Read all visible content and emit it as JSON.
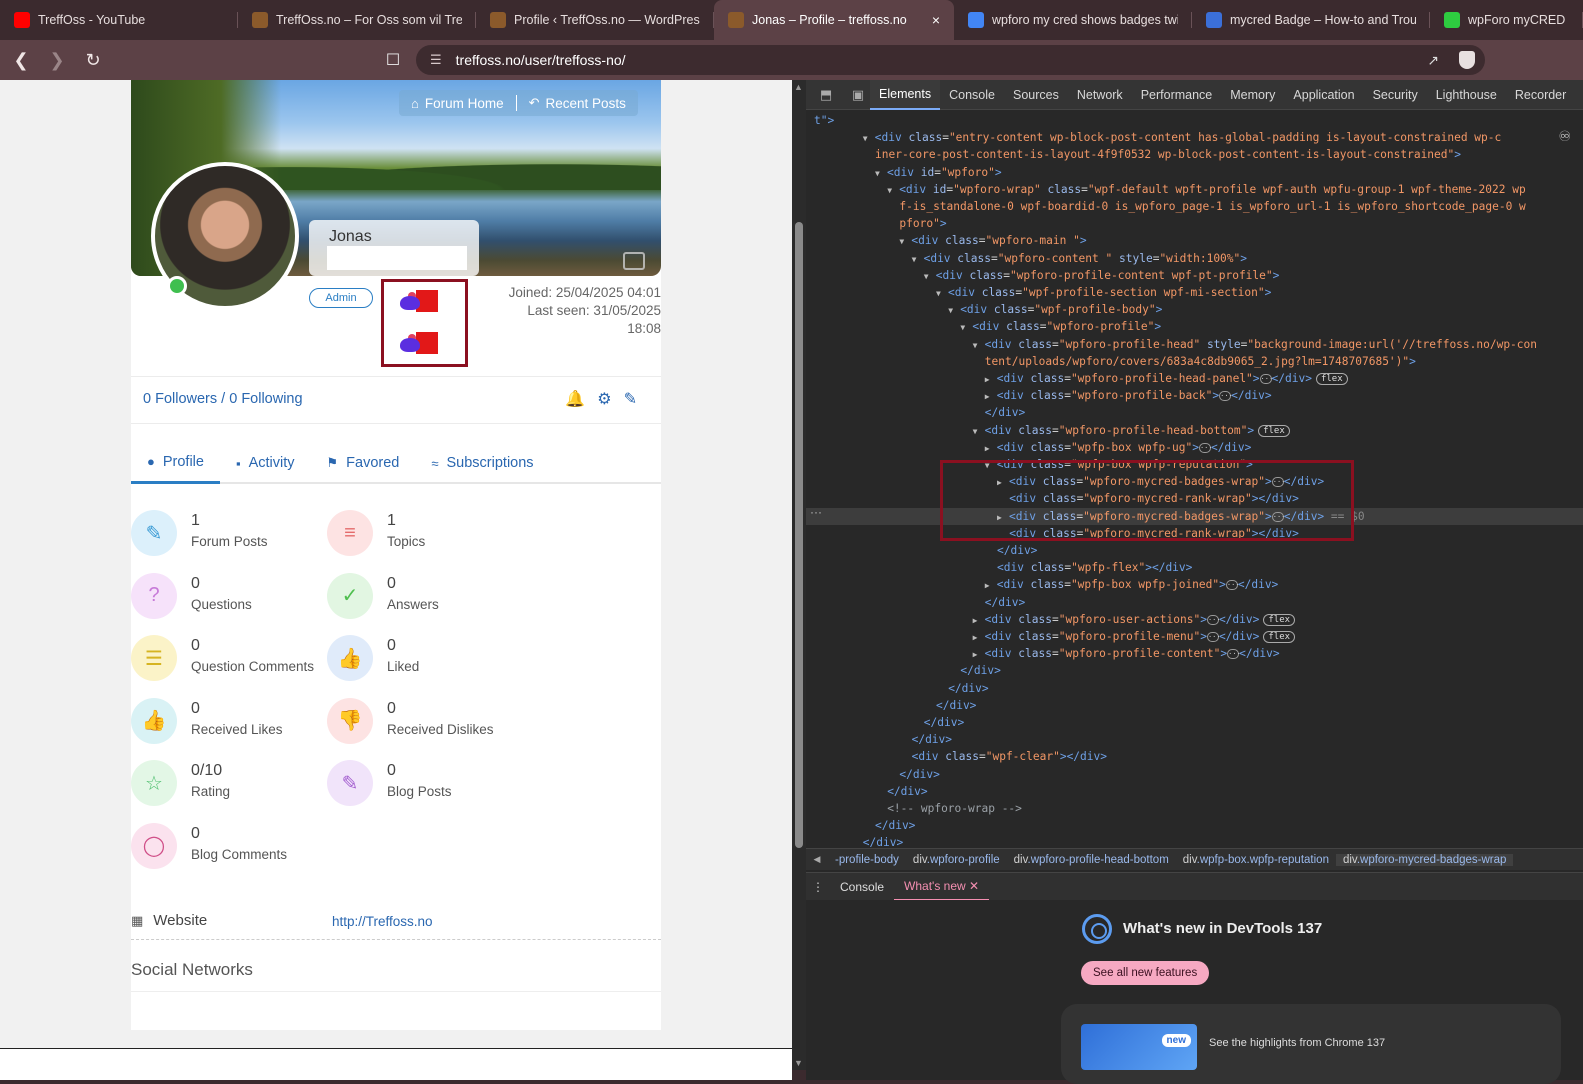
{
  "browser": {
    "tabs": [
      {
        "title": "TreffOss - YouTube",
        "fav": "youtube-icon",
        "color": "#ff0000"
      },
      {
        "title": "TreffOss.no – For Oss som vil Treffe",
        "fav": "treffoss-icon",
        "color": "#8b5a2b"
      },
      {
        "title": "Profile ‹ TreffOss.no — WordPress",
        "fav": "treffoss-icon",
        "color": "#8b5a2b"
      },
      {
        "title": "Jonas – Profile – treffoss.no",
        "fav": "treffoss-icon",
        "color": "#8b5a2b",
        "active": true
      },
      {
        "title": "wpforo my cred shows badges twice",
        "fav": "google-icon",
        "color": "#4285f4"
      },
      {
        "title": "mycred Badge – How-to and Troubl",
        "fav": "f-icon",
        "color": "#3b6fd8"
      },
      {
        "title": "wpForo myCRED Inte",
        "fav": "refresh-icon",
        "color": "#2ecc40"
      }
    ],
    "url": "treffoss.no/user/treffoss-no/"
  },
  "profile": {
    "cover_buttons": {
      "forum_home": "Forum Home",
      "recent_posts": "Recent Posts"
    },
    "name": "Jonas",
    "role_badge": "Admin",
    "joined": "Joined: 25/04/2025 04:01",
    "last_seen": "Last seen: 31/05/2025",
    "last_seen_time": "18:08",
    "followers": "0 Followers / 0 Following",
    "menu": [
      "Profile",
      "Activity",
      "Favored",
      "Subscriptions"
    ],
    "stats": [
      {
        "value": "1",
        "label": "Forum Posts",
        "icon": "pencil-icon",
        "bg": "#dcf0fb",
        "fg": "#3a9bd5"
      },
      {
        "value": "1",
        "label": "Topics",
        "icon": "lines-icon",
        "bg": "#fde3e3",
        "fg": "#e46b6b"
      },
      {
        "value": "0",
        "label": "Questions",
        "icon": "question-icon",
        "bg": "#f6e2fa",
        "fg": "#c77ad8"
      },
      {
        "value": "0",
        "label": "Answers",
        "icon": "check-icon",
        "bg": "#e2f6e2",
        "fg": "#4fbf4f"
      },
      {
        "value": "0",
        "label": "Question Comments",
        "icon": "comment-icon",
        "bg": "#fbf3c8",
        "fg": "#d6b421"
      },
      {
        "value": "0",
        "label": "Liked",
        "icon": "thumbs-up-icon",
        "bg": "#e0ebfa",
        "fg": "#3a75c4"
      },
      {
        "value": "0",
        "label": "Received Likes",
        "icon": "thumbs-up-icon",
        "bg": "#d9f2f5",
        "fg": "#2ba3b1"
      },
      {
        "value": "0",
        "label": "Received Dislikes",
        "icon": "thumbs-down-icon",
        "bg": "#fde3e3",
        "fg": "#e05555"
      },
      {
        "value": "0/10",
        "label": "Rating",
        "icon": "star-icon",
        "bg": "#e3f7e6",
        "fg": "#4fbf6f"
      },
      {
        "value": "0",
        "label": "Blog Posts",
        "icon": "edit-icon",
        "bg": "#f1e4fa",
        "fg": "#a45fd0"
      },
      {
        "value": "0",
        "label": "Blog Comments",
        "icon": "chat-icon",
        "bg": "#fbe2ee",
        "fg": "#d04f88"
      }
    ],
    "website_label": "Website",
    "website_value": "http://Treffoss.no",
    "social_title": "Social Networks"
  },
  "devtools": {
    "tabs": [
      "Elements",
      "Console",
      "Sources",
      "Network",
      "Performance",
      "Memory",
      "Application",
      "Security",
      "Lighthouse",
      "Recorder"
    ],
    "breadcrumbs": [
      {
        "tag": "",
        "cls": "-profile-body"
      },
      {
        "tag": "div",
        "cls": ".wpforo-profile"
      },
      {
        "tag": "div",
        "cls": ".wpforo-profile-head-bottom"
      },
      {
        "tag": "div",
        "cls": ".wpfp-box.wpfp-reputation"
      },
      {
        "tag": "div",
        "cls": ".wpforo-mycred-badges-wrap"
      }
    ],
    "drawer_tabs": [
      "Console",
      "What's new"
    ],
    "whatsnew_title": "What's new in DevTools 137",
    "see_all": "See all new features",
    "highlight_badge": "new",
    "highlight_text": "See the highlights from Chrome 137",
    "code_lines": [
      {
        "i": 0,
        "h": "<span class='tag'>t\"&gt;</span>"
      },
      {
        "i": 4,
        "h": "<span class='tri'>▼</span><span class='tag'>&lt;div</span> <span class='an'>class</span>=<span class='av'>\"entry-content wp-block-post-content has-global-padding is-layout-constrained wp-c</span>"
      },
      {
        "i": 5,
        "h": "<span class='av'>iner-core-post-content-is-layout-4f9f0532 wp-block-post-content-is-layout-constrained\"</span><span class='tag'>&gt;</span>"
      },
      {
        "i": 5,
        "h": "<span class='tri'>▼</span><span class='tag'>&lt;div</span> <span class='an'>id</span>=<span class='av'>\"wpforo\"</span><span class='tag'>&gt;</span>"
      },
      {
        "i": 6,
        "h": "<span class='tri'>▼</span><span class='tag'>&lt;div</span> <span class='an'>id</span>=<span class='av'>\"wpforo-wrap\"</span> <span class='an'>class</span>=<span class='av'>\"wpf-default wpft-profile wpf-auth wpfu-group-1 wpf-theme-2022 wp</span>"
      },
      {
        "i": 7,
        "h": "<span class='av'>f-is_standalone-0 wpf-boardid-0 is_wpforo_page-1 is_wpforo_url-1 is_wpforo_shortcode_page-0 w</span>"
      },
      {
        "i": 7,
        "h": "<span class='av'>pforo\"</span><span class='tag'>&gt;</span>"
      },
      {
        "i": 7,
        "h": "<span class='tri'>▼</span><span class='tag'>&lt;div</span> <span class='an'>class</span>=<span class='av'>\"wpforo-main \"</span><span class='tag'>&gt;</span>"
      },
      {
        "i": 8,
        "h": "<span class='tri'>▼</span><span class='tag'>&lt;div</span> <span class='an'>class</span>=<span class='av'>\"wpforo-content \"</span> <span class='an'>style</span>=<span class='av'>\"width:100%\"</span><span class='tag'>&gt;</span>"
      },
      {
        "i": 9,
        "h": "<span class='tri'>▼</span><span class='tag'>&lt;div</span> <span class='an'>class</span>=<span class='av'>\"wpforo-profile-content wpf-pt-profile\"</span><span class='tag'>&gt;</span>"
      },
      {
        "i": 10,
        "h": "<span class='tri'>▼</span><span class='tag'>&lt;div</span> <span class='an'>class</span>=<span class='av'>\"wpf-profile-section wpf-mi-section\"</span><span class='tag'>&gt;</span>"
      },
      {
        "i": 11,
        "h": "<span class='tri'>▼</span><span class='tag'>&lt;div</span> <span class='an'>class</span>=<span class='av'>\"wpf-profile-body\"</span><span class='tag'>&gt;</span>"
      },
      {
        "i": 12,
        "h": "<span class='tri'>▼</span><span class='tag'>&lt;div</span> <span class='an'>class</span>=<span class='av'>\"wpforo-profile\"</span><span class='tag'>&gt;</span>"
      },
      {
        "i": 13,
        "h": "<span class='tri'>▼</span><span class='tag'>&lt;div</span> <span class='an'>class</span>=<span class='av'>\"wpforo-profile-head\"</span> <span class='an'>style</span>=<span class='av'>\"background-image:url('//treffoss.no/wp-con</span>"
      },
      {
        "i": 14,
        "h": "<span class='av'>tent/uploads/wpforo/covers/683a4c8db9065_2.jpg?lm=1748707685')\"</span><span class='tag'>&gt;</span>"
      },
      {
        "i": 14,
        "h": "<span class='tri'>▶</span><span class='tag'>&lt;div</span> <span class='an'>class</span>=<span class='av'>\"wpforo-profile-head-panel\"</span><span class='tag'>&gt;</span><span class='ell'>···</span><span class='tag'>&lt;/div&gt;</span><span class='flexb'>flex</span>"
      },
      {
        "i": 14,
        "h": "<span class='tri'>▶</span><span class='tag'>&lt;div</span> <span class='an'>class</span>=<span class='av'>\"wpforo-profile-back\"</span><span class='tag'>&gt;</span><span class='ell'>···</span><span class='tag'>&lt;/div&gt;</span>"
      },
      {
        "i": 14,
        "h": "<span class='tag'>&lt;/div&gt;</span>"
      },
      {
        "i": 13,
        "h": "<span class='tri'>▼</span><span class='tag'>&lt;div</span> <span class='an'>class</span>=<span class='av'>\"wpforo-profile-head-bottom\"</span><span class='tag'>&gt;</span><span class='flexb'>flex</span>"
      },
      {
        "i": 14,
        "h": "<span class='tri'>▶</span><span class='tag'>&lt;div</span> <span class='an'>class</span>=<span class='av'>\"wpfp-box wpfp-ug\"</span><span class='tag'>&gt;</span><span class='ell'>···</span><span class='tag'>&lt;/div&gt;</span>"
      },
      {
        "i": 14,
        "h": "<span class='tri'>▼</span><span class='tag'>&lt;div</span> <span class='an'>class</span>=<span class='av'>\"wpfp-box wpfp-reputation\"</span><span class='tag'>&gt;</span>"
      },
      {
        "i": 15,
        "h": "<span class='tri'>▶</span><span class='tag'>&lt;div</span> <span class='an'>class</span>=<span class='av'>\"wpforo-mycred-badges-wrap\"</span><span class='tag'>&gt;</span><span class='ell'>···</span><span class='tag'>&lt;/div&gt;</span>"
      },
      {
        "i": 16,
        "h": "<span class='tag'>&lt;div</span> <span class='an'>class</span>=<span class='av'>\"wpforo-mycred-rank-wrap\"</span><span class='tag'>&gt;&lt;/div&gt;</span>"
      },
      {
        "i": 15,
        "sel": true,
        "h": "<span class='tri'>▶</span><span class='tag'>&lt;div</span> <span class='an'>class</span>=<span class='av'>\"wpforo-mycred-badges-wrap\"</span><span class='tag'>&gt;</span><span class='ell'>···</span><span class='tag'>&lt;/div&gt;</span> <span class='eq0'>== $0</span>"
      },
      {
        "i": 16,
        "h": "<span class='tag'>&lt;div</span> <span class='an'>class</span>=<span class='av'>\"wpforo-mycred-rank-wrap\"</span><span class='tag'>&gt;&lt;/div&gt;</span>"
      },
      {
        "i": 15,
        "h": "<span class='tag'>&lt;/div&gt;</span>"
      },
      {
        "i": 15,
        "h": "<span class='tag'>&lt;div</span> <span class='an'>class</span>=<span class='av'>\"wpfp-flex\"</span><span class='tag'>&gt;&lt;/div&gt;</span>"
      },
      {
        "i": 14,
        "h": "<span class='tri'>▶</span><span class='tag'>&lt;div</span> <span class='an'>class</span>=<span class='av'>\"wpfp-box wpfp-joined\"</span><span class='tag'>&gt;</span><span class='ell'>···</span><span class='tag'>&lt;/div&gt;</span>"
      },
      {
        "i": 14,
        "h": "<span class='tag'>&lt;/div&gt;</span>"
      },
      {
        "i": 13,
        "h": "<span class='tri'>▶</span><span class='tag'>&lt;div</span> <span class='an'>class</span>=<span class='av'>\"wpforo-user-actions\"</span><span class='tag'>&gt;</span><span class='ell'>···</span><span class='tag'>&lt;/div&gt;</span><span class='flexb'>flex</span>"
      },
      {
        "i": 13,
        "h": "<span class='tri'>▶</span><span class='tag'>&lt;div</span> <span class='an'>class</span>=<span class='av'>\"wpforo-profile-menu\"</span><span class='tag'>&gt;</span><span class='ell'>···</span><span class='tag'>&lt;/div&gt;</span><span class='flexb'>flex</span>"
      },
      {
        "i": 13,
        "h": "<span class='tri'>▶</span><span class='tag'>&lt;div</span> <span class='an'>class</span>=<span class='av'>\"wpforo-profile-content\"</span><span class='tag'>&gt;</span><span class='ell'>···</span><span class='tag'>&lt;/div&gt;</span>"
      },
      {
        "i": 12,
        "h": "<span class='tag'>&lt;/div&gt;</span>"
      },
      {
        "i": 11,
        "h": "<span class='tag'>&lt;/div&gt;</span>"
      },
      {
        "i": 10,
        "h": "<span class='tag'>&lt;/div&gt;</span>"
      },
      {
        "i": 9,
        "h": "<span class='tag'>&lt;/div&gt;</span>"
      },
      {
        "i": 8,
        "h": "<span class='tag'>&lt;/div&gt;</span>"
      },
      {
        "i": 8,
        "h": "<span class='tag'>&lt;div</span> <span class='an'>class</span>=<span class='av'>\"wpf-clear\"</span><span class='tag'>&gt;&lt;/div&gt;</span>"
      },
      {
        "i": 7,
        "h": "<span class='tag'>&lt;/div&gt;</span>"
      },
      {
        "i": 6,
        "h": "<span class='tag'>&lt;/div&gt;</span>"
      },
      {
        "i": 6,
        "h": "<span class='cm'>&lt;!-- wpforo-wrap --&gt;</span>"
      },
      {
        "i": 5,
        "h": "<span class='tag'>&lt;/div&gt;</span>"
      },
      {
        "i": 4,
        "h": "<span class='tag'>&lt;/div&gt;</span>"
      }
    ]
  }
}
